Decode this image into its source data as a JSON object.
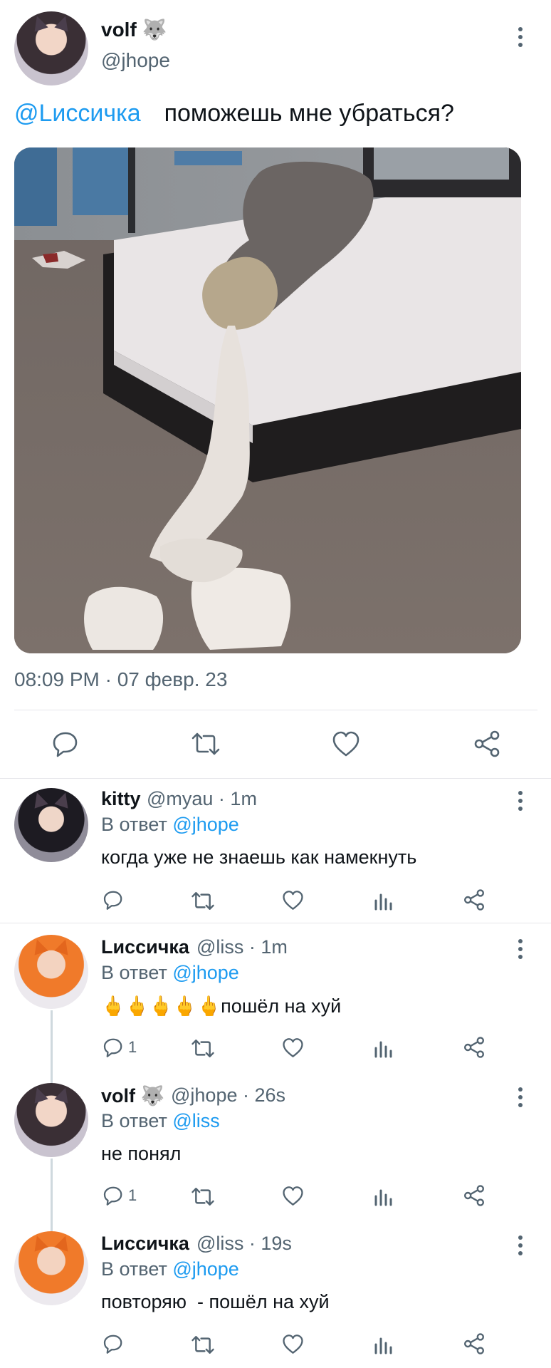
{
  "tweet": {
    "name": "volf 🐺",
    "handle": "@jhope",
    "mention": "@Lиссичка",
    "text": "поможешь мне убраться?",
    "timestamp": "08:09 PM · 07 февр. 23",
    "image_icon": "bed-with-sheets-photo"
  },
  "reply_prefix": "В ответ",
  "replies": [
    {
      "name": "kitty",
      "meta": "@myau · 1m",
      "reply_to": "@jhope",
      "text": "когда уже не знаешь как намекнуть",
      "reply_count": ""
    },
    {
      "name": "Lиссичка",
      "meta": "@liss · 1m",
      "reply_to": "@jhope",
      "text": "🖕🖕🖕🖕🖕пошёл на хуй",
      "reply_count": "1"
    },
    {
      "name": "volf 🐺",
      "meta": "@jhope · 26s",
      "reply_to": "@liss",
      "text": "не понял",
      "reply_count": "1"
    },
    {
      "name": "Lиссичка",
      "meta": "@liss · 19s",
      "reply_to": "@jhope",
      "text": "повторяю  - пошёл на хуй",
      "reply_count": ""
    }
  ],
  "icons": {
    "reply": "reply-icon",
    "retweet": "retweet-icon",
    "like": "like-icon",
    "stats": "stats-icon",
    "share": "share-icon",
    "more": "more-options-icon"
  },
  "colors": {
    "accent": "#1d9bf0",
    "secondary_text": "#536471",
    "primary_text": "#0f1419"
  }
}
